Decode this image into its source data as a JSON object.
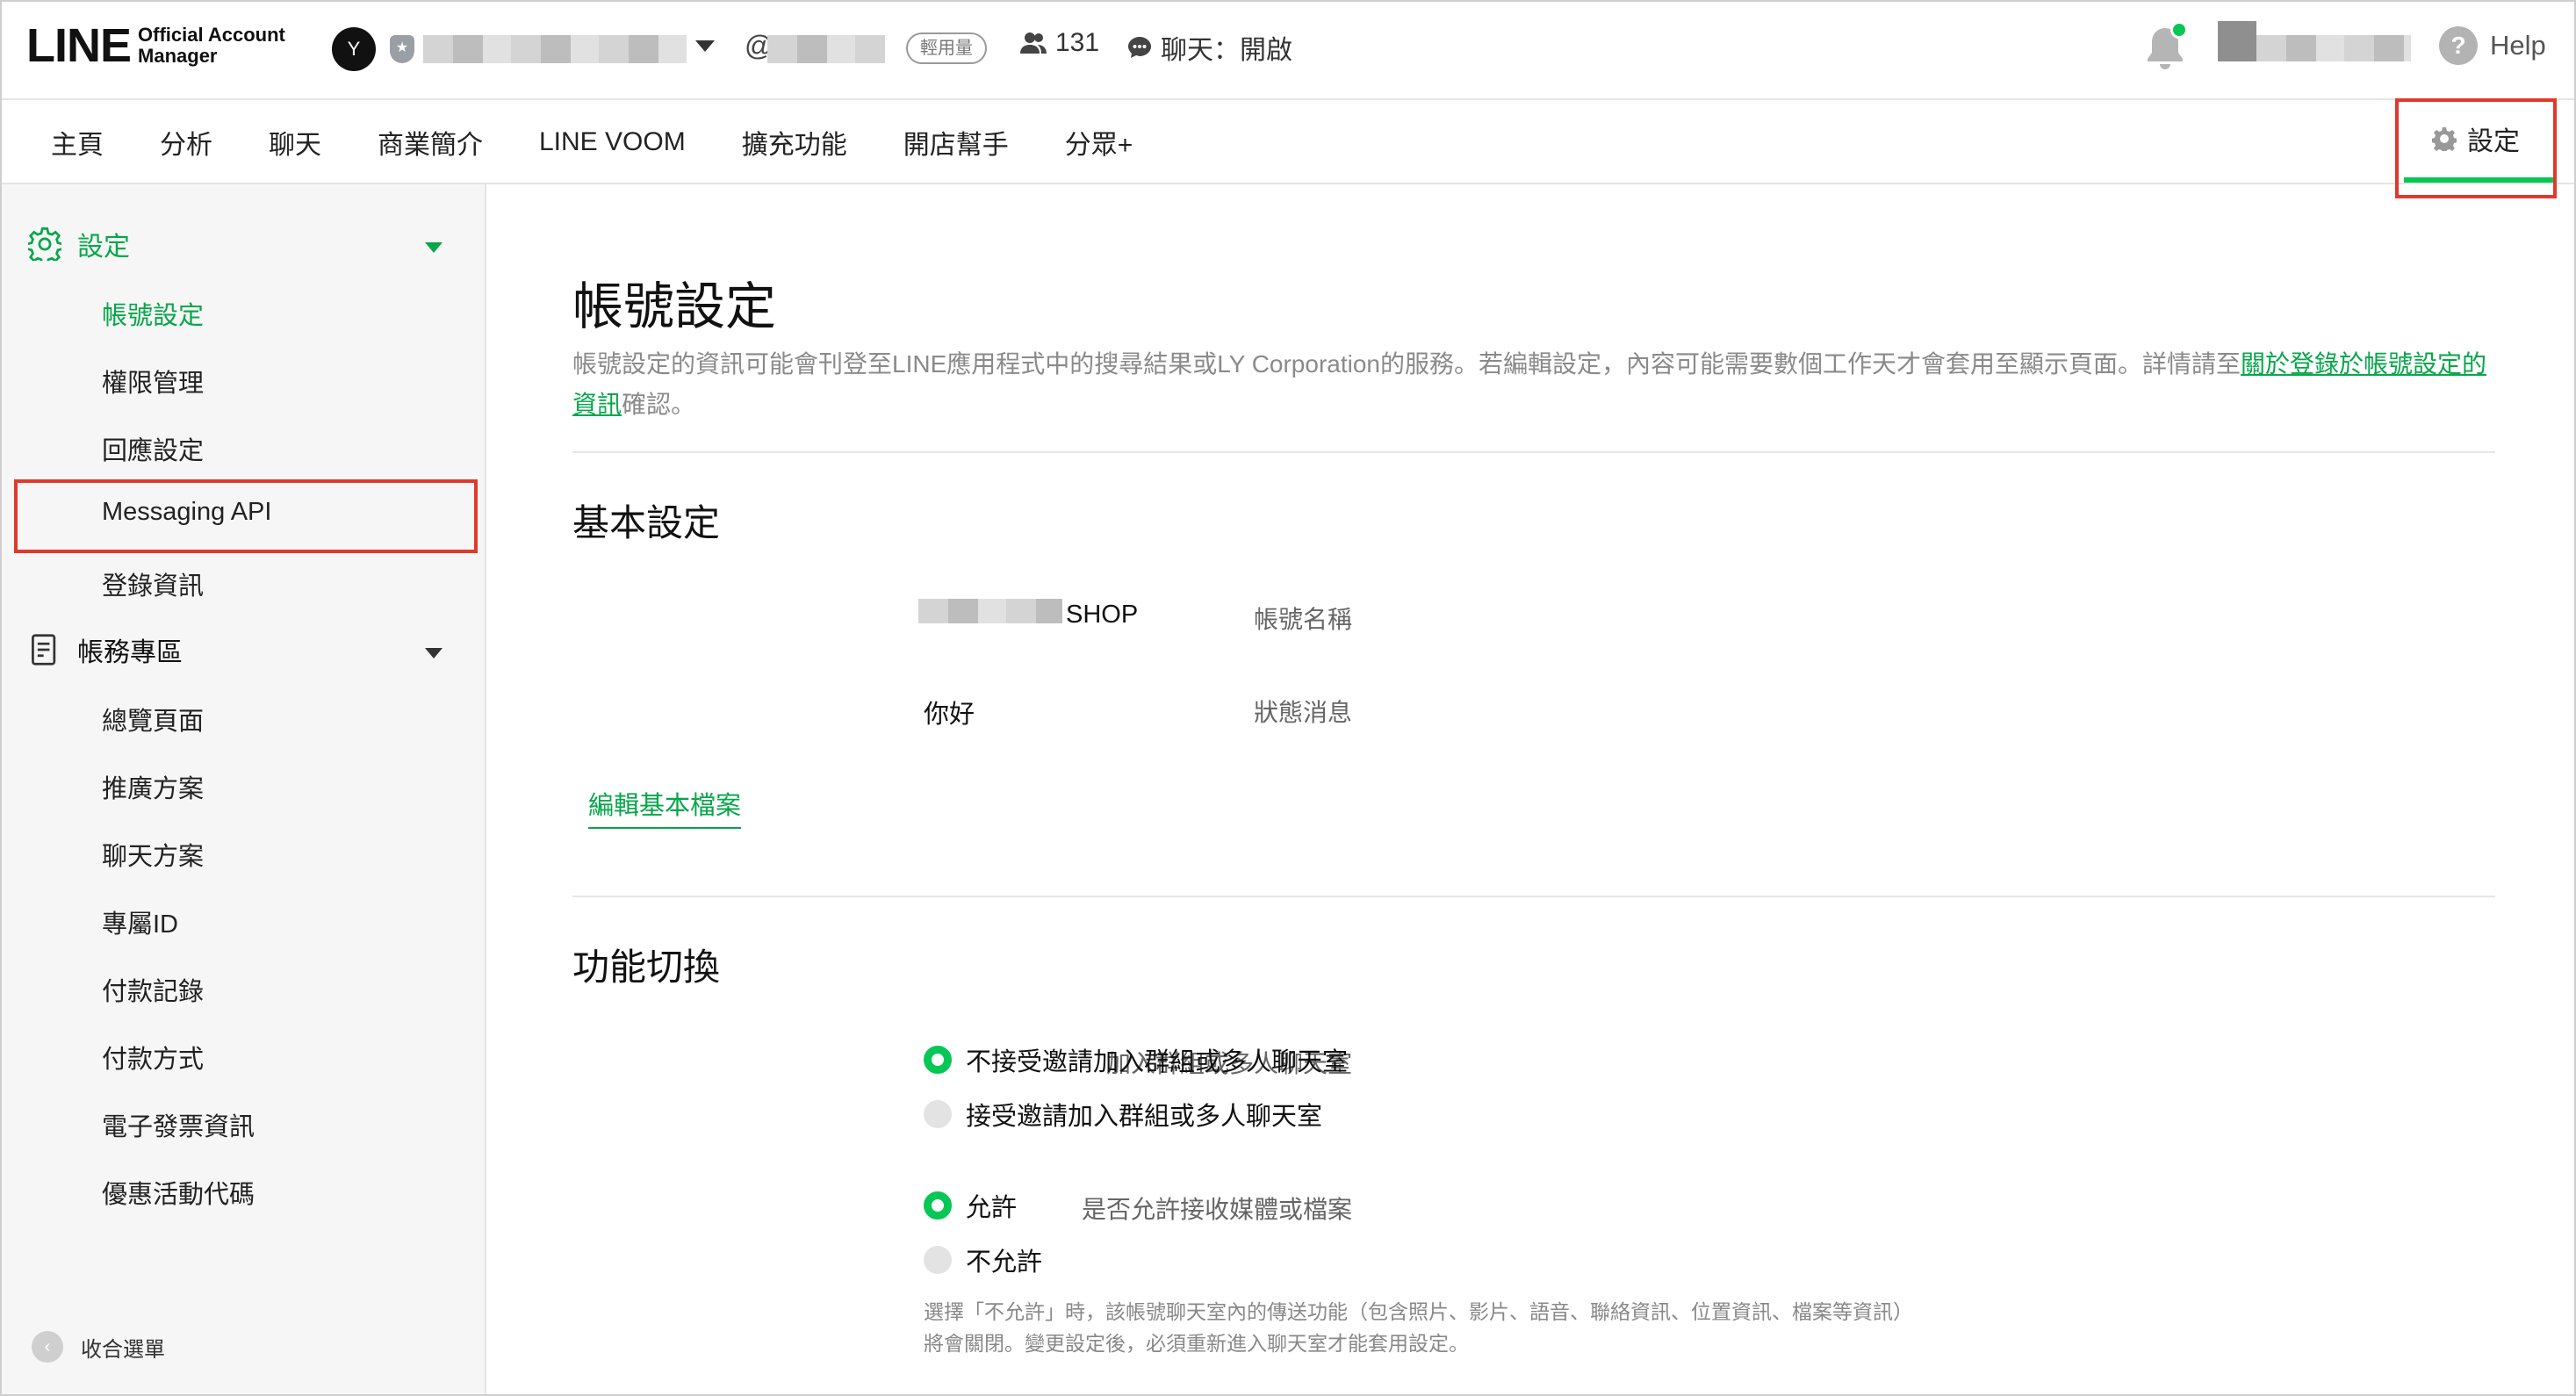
{
  "brand": {
    "logo_text": "LINE",
    "logo_sub_1": "Official Account",
    "logo_sub_2": "Manager"
  },
  "account": {
    "avatar_glyph": "Y",
    "at_prefix": "@",
    "plan_badge": "輕用量",
    "friend_count": "131",
    "chat_status": "聊天：開啟"
  },
  "header": {
    "help_label": "Help"
  },
  "nav": {
    "items": [
      "主頁",
      "分析",
      "聊天",
      "商業簡介",
      "LINE VOOM",
      "擴充功能",
      "開店幫手",
      "分眾+"
    ],
    "settings_label": "設定"
  },
  "sidebar": {
    "section1": {
      "label": "設定",
      "items": [
        "帳號設定",
        "權限管理",
        "回應設定",
        "Messaging API",
        "登錄資訊"
      ]
    },
    "section2": {
      "label": "帳務專區",
      "items": [
        "總覽頁面",
        "推廣方案",
        "聊天方案",
        "專屬ID",
        "付款記錄",
        "付款方式",
        "電子發票資訊",
        "優惠活動代碼"
      ]
    },
    "collapse_label": "收合選單"
  },
  "page": {
    "title": "帳號設定",
    "desc_text": "帳號設定的資訊可能會刊登至LINE應用程式中的搜尋結果或LY Corporation的服務。若編輯設定，內容可能需要數個工作天才會套用至顯示頁面。詳情請至",
    "desc_link": "關於登錄於帳號設定的資訊",
    "desc_tail": "確認。"
  },
  "basic": {
    "heading": "基本設定",
    "name_label": "帳號名稱",
    "name_suffix": "SHOP",
    "status_label": "狀態消息",
    "status_value": "你好",
    "edit_link": "編輯基本檔案"
  },
  "features": {
    "heading": "功能切換",
    "group_label": "加入群組或多人聊天室",
    "group_options": [
      "不接受邀請加入群組或多人聊天室",
      "接受邀請加入群組或多人聊天室"
    ],
    "group_selected": 0,
    "media_label": "是否允許接收媒體或檔案",
    "media_options": [
      "允許",
      "不允許"
    ],
    "media_selected": 0,
    "media_note": "選擇「不允許」時，該帳號聊天室內的傳送功能（包含照片、影片、語音、聯絡資訊、位置資訊、檔案等資訊）將會關閉。變更設定後，必須重新進入聊天室才能套用設定。"
  },
  "colors": {
    "accent": "#06c755",
    "link": "#06a64a",
    "highlight": "#e0392b"
  }
}
